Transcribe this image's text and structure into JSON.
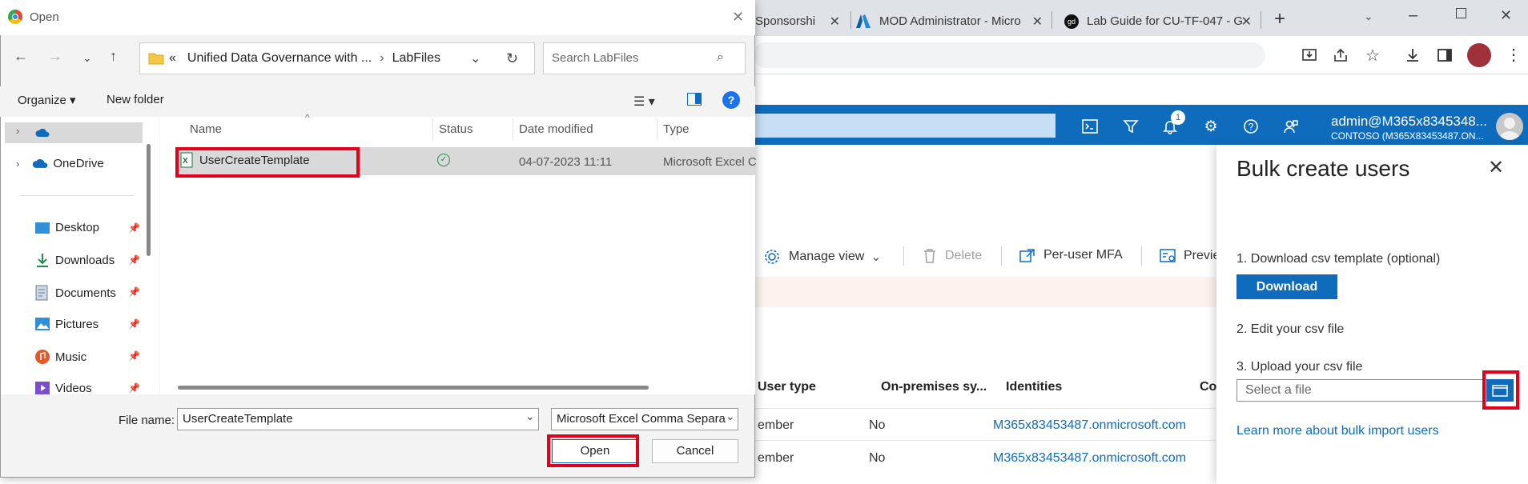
{
  "browser": {
    "tabs": [
      {
        "title": "Sponsorshi",
        "favicon": "generic-icon"
      },
      {
        "title": "MOD Administrator - Micro",
        "favicon": "azure-icon"
      },
      {
        "title": "Lab Guide for CU-TF-047 - G",
        "favicon": "gd-icon"
      }
    ],
    "new_tab": "+"
  },
  "azure": {
    "account_name": "admin@M365x8345348...",
    "account_org": "CONTOSO (M365X83453487.ON...",
    "notification_count": "1"
  },
  "users_page": {
    "commands": [
      "Manage view",
      "Delete",
      "Per-user MFA",
      "Previe"
    ],
    "columns": [
      "User type",
      "On-premises sy...",
      "Identities",
      "Co"
    ],
    "rows": [
      {
        "user_type": "ember",
        "on_prem": "No",
        "identity": "M365x83453487.onmicrosoft.com"
      },
      {
        "user_type": "ember",
        "on_prem": "No",
        "identity": "M365x83453487.onmicrosoft.com"
      }
    ]
  },
  "bulk_panel": {
    "title": "Bulk create users",
    "step1": "1. Download csv template (optional)",
    "download_label": "Download",
    "step2": "2. Edit your csv file",
    "step3": "3. Upload your csv file",
    "file_placeholder": "Select a file",
    "learn_more": "Learn more about bulk import users"
  },
  "dialog": {
    "title": "Open",
    "breadcrumb_prefix": "«",
    "breadcrumb_1": "Unified Data Governance with ...",
    "breadcrumb_sep": "›",
    "breadcrumb_2": "LabFiles",
    "search_placeholder": "Search LabFiles",
    "organize": "Organize ▾",
    "new_folder": "New folder",
    "nav_items": [
      "OneDrive",
      "Desktop",
      "Downloads",
      "Documents",
      "Pictures",
      "Music",
      "Videos"
    ],
    "list_headers": [
      "Name",
      "Status",
      "Date modified",
      "Type"
    ],
    "file": {
      "name": "UserCreateTemplate",
      "date": "04-07-2023 11:11",
      "type": "Microsoft Excel C"
    },
    "file_name_label": "File name:",
    "file_name_value": "UserCreateTemplate",
    "file_type_value": "Microsoft Excel Comma Separa",
    "open_label": "Open",
    "cancel_label": "Cancel"
  },
  "colors": {
    "azure_blue": "#0f6cbd",
    "highlight_red": "#e3001b"
  }
}
